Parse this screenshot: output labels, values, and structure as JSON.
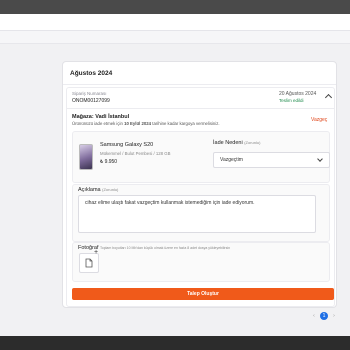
{
  "section": {
    "title": "Ağustos 2024"
  },
  "order": {
    "number_label": "Sipariş Numarası",
    "number_value": "ONOM00127099",
    "date": "20 Ağustos 2024",
    "status": "Teslim edildi"
  },
  "store": {
    "title": "Mağaza: Vadi İstanbul",
    "note_prefix": "Ürününüzü iade etmek için ",
    "note_date": "10 Eylül 2024",
    "note_suffix": " tarihine kadar kargoya vermelisiniz.",
    "cancel_label": "Vazgeç"
  },
  "product": {
    "name": "Samsung Galaxy S20",
    "variant": "Mükemmel / Bulut Pembesi / 128 GB",
    "price": "₺ 9.950"
  },
  "return_reason": {
    "label": "İade Nedeni",
    "required": "(Zorunlu)",
    "selected": "Vazgeçtim"
  },
  "description": {
    "label": "Açıklama",
    "required": "(Zorunlu)",
    "value": "cihaz elime ulaştı fakat vazgeçtim kullanmak istemediğim için iade ediyorum."
  },
  "photo": {
    "label": "Fotoğraf",
    "hint": "Toplam boyutları 10 Mb'dan küçük olmak üzere en fazla 8 adet dosya yükleyebilirsin"
  },
  "submit_label": "Talep Oluştur",
  "pagination": {
    "current": "1"
  },
  "colors": {
    "accent": "#f05a1a",
    "pager_active": "#1f6fe5"
  }
}
